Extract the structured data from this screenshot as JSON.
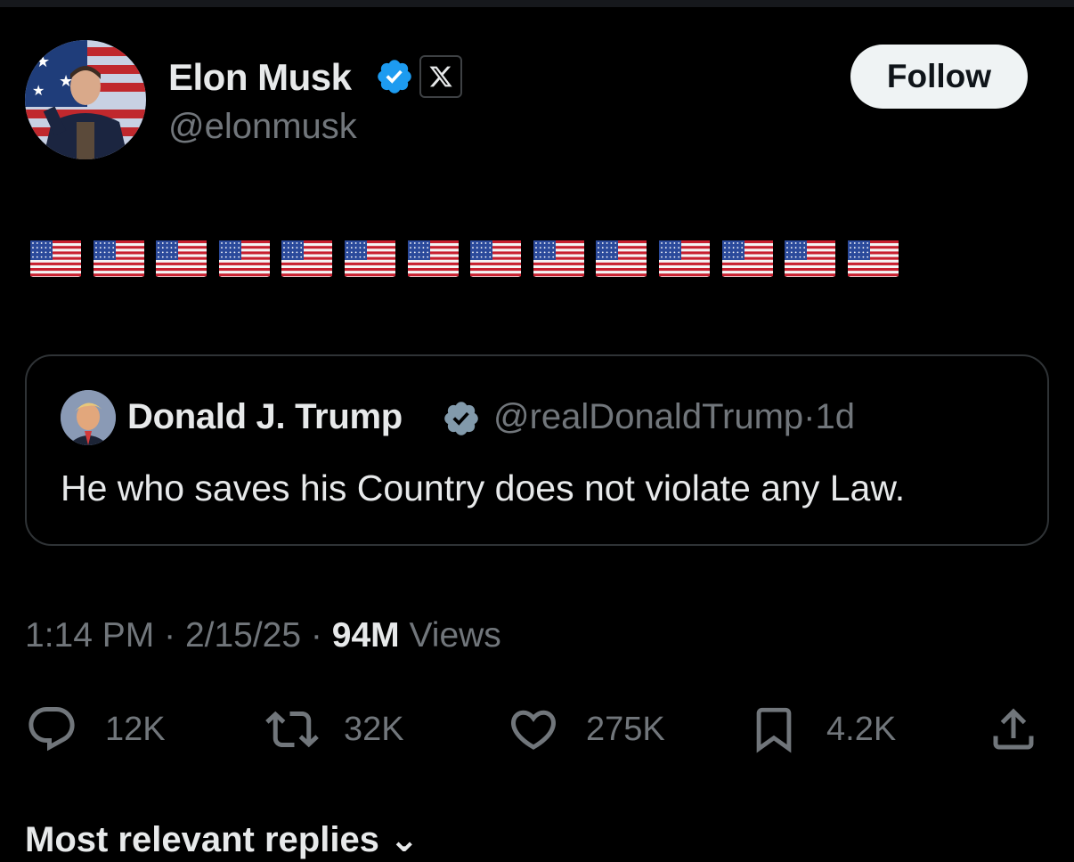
{
  "author": {
    "name": "Elon Musk",
    "handle": "@elonmusk",
    "verified": true,
    "affiliate_badge_icon": "x-logo-icon"
  },
  "follow_label": "Follow",
  "body_flags": [
    "🇺🇸",
    "🇺🇸",
    "🇺🇸",
    "🇺🇸",
    "🇺🇸",
    "🇺🇸",
    "🇺🇸",
    "🇺🇸",
    "🇺🇸",
    "🇺🇸",
    "🇺🇸",
    "🇺🇸",
    "🇺🇸",
    "🇺🇸"
  ],
  "quoted": {
    "name": "Donald J. Trump",
    "handle": "@realDonaldTrump",
    "separator": "·",
    "age": "1d",
    "text": "He who saves his Country does not violate any Law."
  },
  "meta": {
    "time": "1:14 PM",
    "date": "2/15/25",
    "views_count": "94M",
    "views_label": "Views"
  },
  "actions": {
    "replies": "12K",
    "reposts": "32K",
    "likes": "275K",
    "bookmarks": "4.2K"
  },
  "replies_header": "Most relevant replies",
  "colors": {
    "background": "#000000",
    "text_primary": "#e7e9ea",
    "text_secondary": "#71767b",
    "verified_blue": "#1d9bf0",
    "border": "#2f3336"
  }
}
